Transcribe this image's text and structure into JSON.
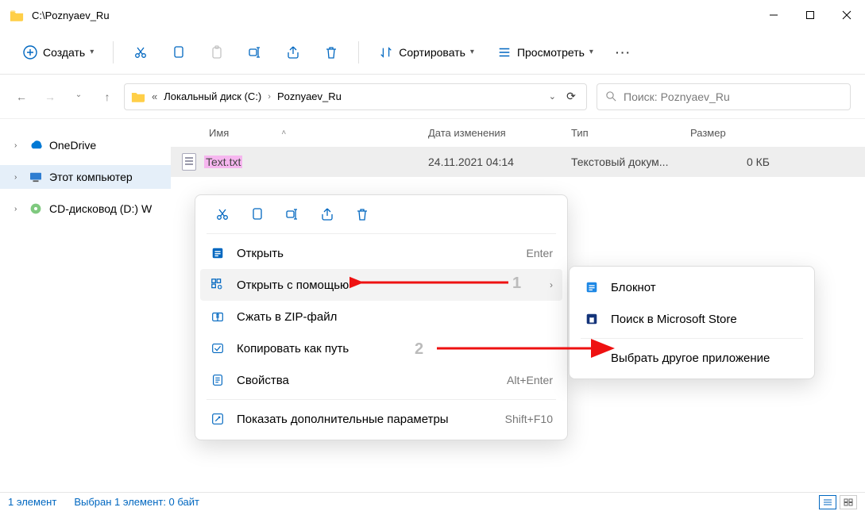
{
  "titlebar": {
    "title": "C:\\Poznyaev_Ru"
  },
  "toolbar": {
    "new_label": "Создать",
    "sort_label": "Сортировать",
    "view_label": "Просмотреть"
  },
  "breadcrumb": {
    "seg1": "Локальный диск (C:)",
    "seg2": "Poznyaev_Ru"
  },
  "search": {
    "placeholder": "Поиск: Poznyaev_Ru"
  },
  "nav": {
    "items": [
      {
        "label": "OneDrive"
      },
      {
        "label": "Этот компьютер"
      },
      {
        "label": "CD-дисковод (D:) W"
      }
    ]
  },
  "columns": {
    "name": "Имя",
    "modified": "Дата изменения",
    "type": "Тип",
    "size": "Размер"
  },
  "file": {
    "name": "Text.txt",
    "modified": "24.11.2021 04:14",
    "type": "Текстовый докум...",
    "size": "0 КБ"
  },
  "ctx": {
    "open": "Открыть",
    "open_hint": "Enter",
    "openwith": "Открыть с помощью",
    "zip": "Сжать в ZIP-файл",
    "copypath": "Копировать как путь",
    "props": "Свойства",
    "props_hint": "Alt+Enter",
    "more": "Показать дополнительные параметры",
    "more_hint": "Shift+F10"
  },
  "sub": {
    "notepad": "Блокнот",
    "store": "Поиск в Microsoft Store",
    "choose": "Выбрать другое приложение"
  },
  "annotations": {
    "n1": "1",
    "n2": "2"
  },
  "status": {
    "count": "1 элемент",
    "sel": "Выбран 1 элемент: 0 байт"
  }
}
